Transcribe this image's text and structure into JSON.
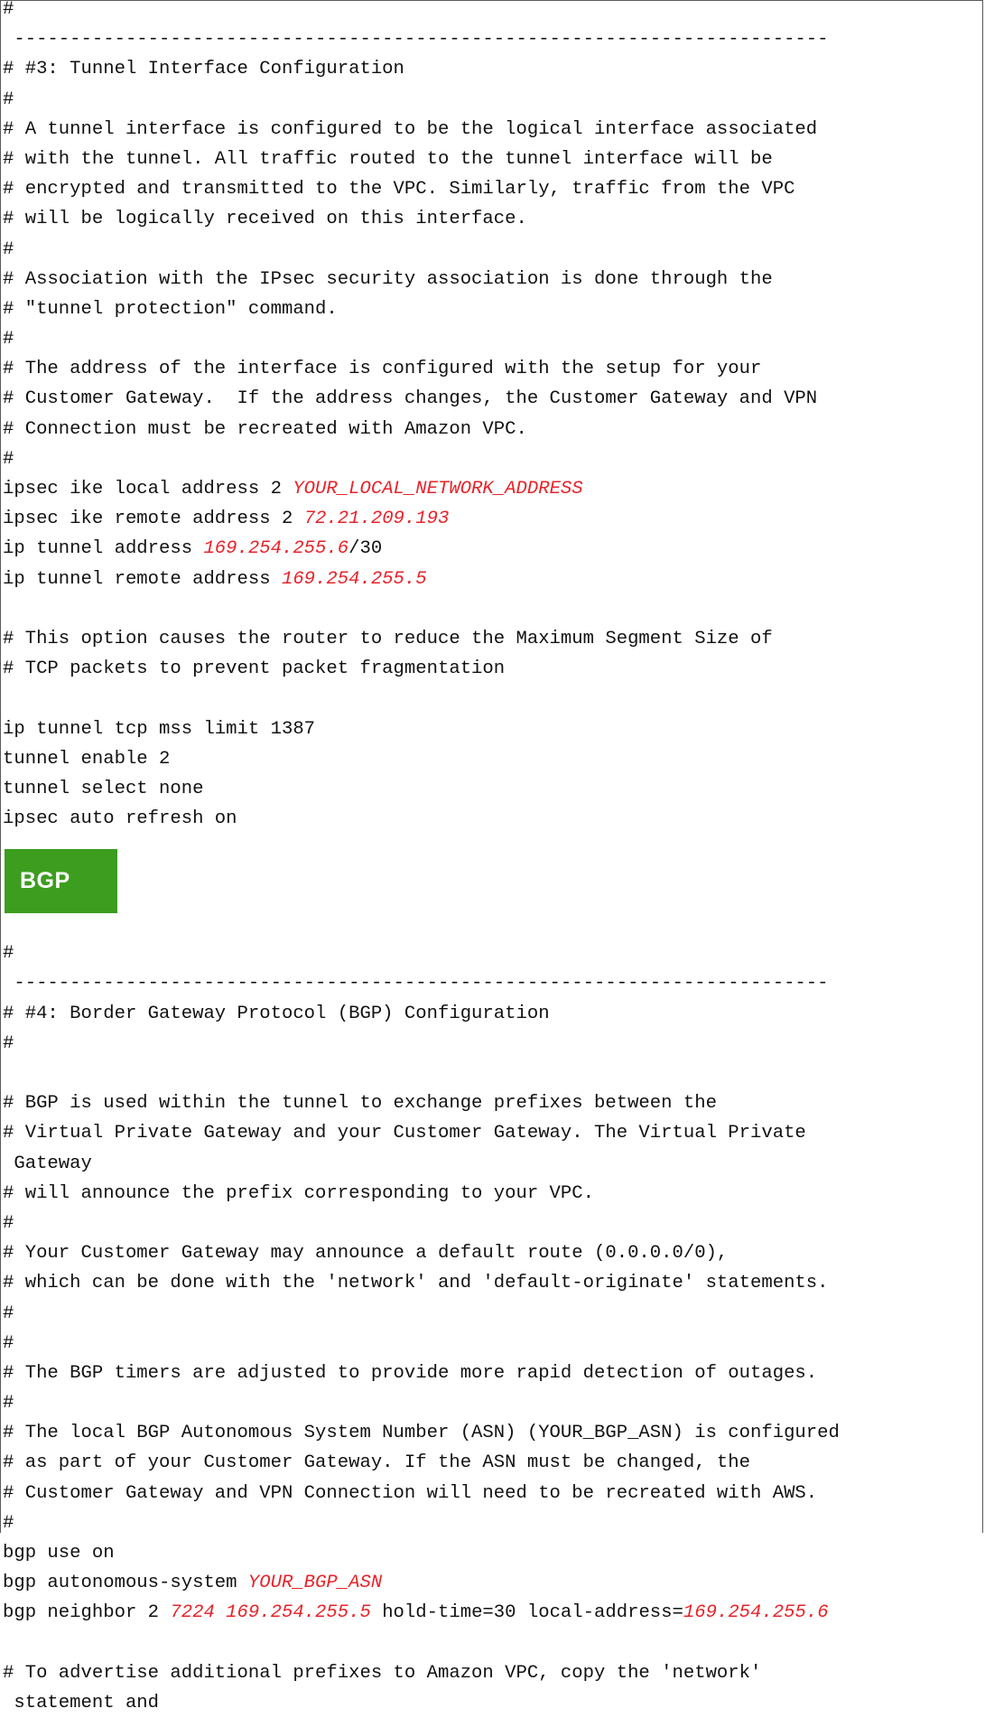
{
  "section3": {
    "lines": [
      "#",
      " -------------------------------------------------------------------------",
      "# #3: Tunnel Interface Configuration",
      "#",
      "# A tunnel interface is configured to be the logical interface associated",
      "# with the tunnel. All traffic routed to the tunnel interface will be",
      "# encrypted and transmitted to the VPC. Similarly, traffic from the VPC",
      "# will be logically received on this interface.",
      "#",
      "# Association with the IPsec security association is done through the",
      "# \"tunnel protection\" command.",
      "#",
      "# The address of the interface is configured with the setup for your",
      "# Customer Gateway.  If the address changes, the Customer Gateway and VPN",
      "# Connection must be recreated with Amazon VPC.",
      "#"
    ],
    "ike_local_prefix": "ipsec ike local address 2 ",
    "ike_local_value": "YOUR_LOCAL_NETWORK_ADDRESS",
    "ike_remote_prefix": "ipsec ike remote address 2 ",
    "ike_remote_value": "72.21.209.193",
    "tunnel_address_prefix": "ip tunnel address ",
    "tunnel_address_value": "169.254.255.6",
    "tunnel_address_suffix": "/30",
    "tunnel_remote_prefix": "ip tunnel remote address ",
    "tunnel_remote_value": "169.254.255.5",
    "mss_comment_1": "# This option causes the router to reduce the Maximum Segment Size of",
    "mss_comment_2": "# TCP packets to prevent packet fragmentation",
    "cmd_mss": "ip tunnel tcp mss limit 1387",
    "cmd_enable": "tunnel enable 2",
    "cmd_select": "tunnel select none",
    "cmd_refresh": "ipsec auto refresh on"
  },
  "bgp_badge": {
    "label": "BGP",
    "color": "#3c9d1f"
  },
  "section4": {
    "lines": [
      "#",
      " -------------------------------------------------------------------------",
      "# #4: Border Gateway Protocol (BGP) Configuration",
      "#",
      "",
      "# BGP is used within the tunnel to exchange prefixes between the",
      "# Virtual Private Gateway and your Customer Gateway. The Virtual Private",
      " Gateway",
      "# will announce the prefix corresponding to your VPC.",
      "#",
      "# Your Customer Gateway may announce a default route (0.0.0.0/0),",
      "# which can be done with the 'network' and 'default-originate' statements.",
      "#",
      "#",
      "# The BGP timers are adjusted to provide more rapid detection of outages.",
      "#",
      "# The local BGP Autonomous System Number (ASN) (YOUR_BGP_ASN) is configured",
      "# as part of your Customer Gateway. If the ASN must be changed, the",
      "# Customer Gateway and VPN Connection will need to be recreated with AWS.",
      "#"
    ],
    "cmd_bgp_use": "bgp use on",
    "asn_prefix": "bgp autonomous-system ",
    "asn_value": "YOUR_BGP_ASN",
    "neighbor_prefix": "bgp neighbor 2 ",
    "neighbor_asn": "7224",
    "neighbor_space": " ",
    "neighbor_ip": "169.254.255.5",
    "neighbor_mid": " hold-time=30 local-address=",
    "neighbor_local": "169.254.255.6",
    "advertise_1": "# To advertise additional prefixes to Amazon VPC, copy the 'network'",
    "advertise_2": " statement and"
  },
  "colors": {
    "highlight": "#e8232a",
    "text": "#111111",
    "border": "#5a5a5a"
  }
}
